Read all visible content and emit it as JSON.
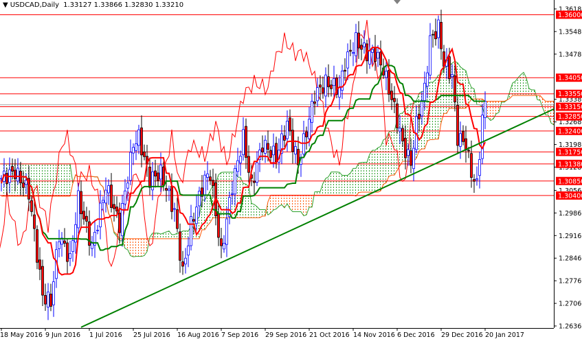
{
  "header": {
    "symbol": "USDCAD,Daily",
    "open": "1.33127",
    "high": "1.33866",
    "low": "1.32830",
    "close": "1.33210"
  },
  "chart_data": {
    "type": "candlestick",
    "title": "USDCAD,Daily",
    "indicator": "Ichimoku Kinko Hyo",
    "ylim": [
      1.2636,
      1.3618
    ],
    "y_ticks": [
      "1.36180",
      "1.35480",
      "1.34780",
      "1.33380",
      "1.32680",
      "1.31980",
      "1.31280",
      "1.30560",
      "1.29860",
      "1.29160",
      "1.28460",
      "1.27760",
      "1.27060",
      "1.26360"
    ],
    "x_ticks": [
      "18 May 2016",
      "9 Jun 2016",
      "1 Jul 2016",
      "25 Jul 2016",
      "16 Aug 2016",
      "7 Sep 2016",
      "29 Sep 2016",
      "21 Oct 2016",
      "14 Nov 2016",
      "6 Dec 2016",
      "29 Dec 2016",
      "20 Jan 2017"
    ],
    "bars_per_x_tick": 16,
    "total_bars": 177,
    "price_path": [
      [
        0,
        1.3093
      ],
      [
        5,
        1.3114
      ],
      [
        10,
        1.305
      ],
      [
        15,
        1.273
      ],
      [
        18,
        1.271
      ],
      [
        21,
        1.292
      ],
      [
        25,
        1.284
      ],
      [
        28,
        1.303
      ],
      [
        33,
        1.288
      ],
      [
        38,
        1.307
      ],
      [
        43,
        1.295
      ],
      [
        48,
        1.32
      ],
      [
        50,
        1.322
      ],
      [
        54,
        1.309
      ],
      [
        58,
        1.311
      ],
      [
        63,
        1.299
      ],
      [
        66,
        1.28
      ],
      [
        69,
        1.295
      ],
      [
        74,
        1.309
      ],
      [
        76,
        1.311
      ],
      [
        80,
        1.286
      ],
      [
        84,
        1.307
      ],
      [
        88,
        1.322
      ],
      [
        91,
        1.307
      ],
      [
        95,
        1.32
      ],
      [
        100,
        1.316
      ],
      [
        104,
        1.326
      ],
      [
        108,
        1.314
      ],
      [
        111,
        1.324
      ],
      [
        114,
        1.335
      ],
      [
        118,
        1.339
      ],
      [
        123,
        1.337
      ],
      [
        125,
        1.345
      ],
      [
        129,
        1.352
      ],
      [
        133,
        1.348
      ],
      [
        136,
        1.348
      ],
      [
        139,
        1.343
      ],
      [
        143,
        1.331
      ],
      [
        146,
        1.32
      ],
      [
        149,
        1.314
      ],
      [
        151,
        1.326
      ],
      [
        154,
        1.337
      ],
      [
        156,
        1.352
      ],
      [
        159,
        1.356
      ],
      [
        161,
        1.345
      ],
      [
        164,
        1.341
      ],
      [
        166,
        1.322
      ],
      [
        169,
        1.32
      ],
      [
        171,
        1.311
      ],
      [
        173,
        1.307
      ],
      [
        175,
        1.328
      ],
      [
        176,
        1.3321
      ]
    ],
    "levels": [
      {
        "label": "1.36000",
        "price": 1.36
      },
      {
        "label": "1.34050",
        "price": 1.3405
      },
      {
        "label": "1.33550",
        "price": 1.3355
      },
      {
        "label": "1.33150",
        "price": 1.3315
      },
      {
        "label": "1.32850",
        "price": 1.3285
      },
      {
        "label": "1.32400",
        "price": 1.324
      },
      {
        "label": "1.31750",
        "price": 1.3175
      },
      {
        "label": "1.31380",
        "price": 1.3138
      },
      {
        "label": "1.30850",
        "price": 1.3085
      },
      {
        "label": "1.30400",
        "price": 1.304
      }
    ],
    "current_price": 1.3321,
    "trendline": {
      "start_bar": 29,
      "start_price": 1.2632,
      "end_bar": 201,
      "end_price": 1.3308
    },
    "colors": {
      "up": "#0000ff",
      "down": "#ff0000",
      "tenkan": "#ff0000",
      "kijun": "#008000",
      "level": "#ff0000",
      "trend": "#008000",
      "cloud_up": "#2ca02c",
      "cloud_down": "#ff5500"
    }
  }
}
